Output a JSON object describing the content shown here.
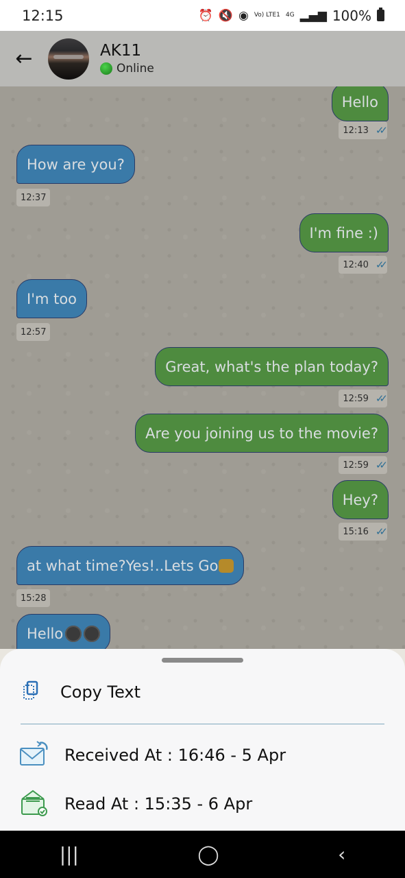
{
  "status": {
    "time": "12:15",
    "network": "Vo) LTE1",
    "net_type": "4G",
    "battery": "100%"
  },
  "header": {
    "name": "AK11",
    "status": "Online"
  },
  "messages": [
    {
      "text": "Hello",
      "time": "12:13"
    },
    {
      "text": "How are you?",
      "time": "12:37"
    },
    {
      "text": "I'm fine :)",
      "time": "12:40"
    },
    {
      "text": "I'm too",
      "time": "12:57"
    },
    {
      "text": "Great, what's the plan today?",
      "time": "12:59"
    },
    {
      "text": "Are you joining us to the movie?",
      "time": "12:59"
    },
    {
      "text": "Hey?",
      "time": "15:16"
    },
    {
      "text": "at what time?Yes!..Lets Go",
      "time": "15:28"
    },
    {
      "text": "Hello",
      "time": ""
    }
  ],
  "sheet": {
    "copy": "Copy Text",
    "received": "Received At : 16:46 - 5 Apr",
    "read": "Read At : 15:35 - 6 Apr"
  },
  "icons": {
    "back": "arrow-left-icon",
    "ticks": "double-check-icon",
    "copy": "copy-icon",
    "received": "mail-received-icon",
    "read": "mail-read-icon"
  },
  "colors": {
    "outgoing": "#4e8b3f",
    "incoming": "#3a7aa8",
    "ticks": "#2f6f95"
  }
}
